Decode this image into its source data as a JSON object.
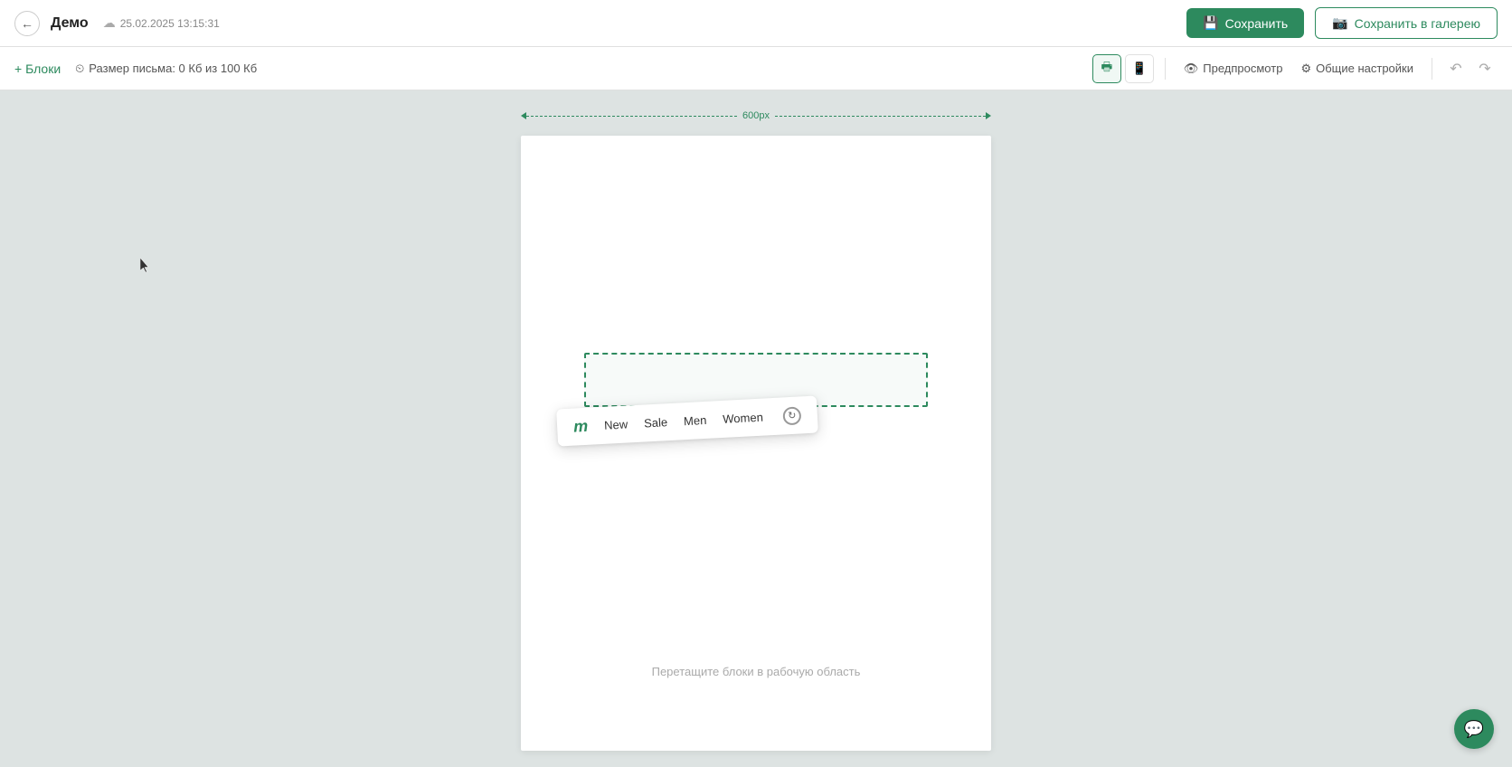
{
  "header": {
    "back_label": "←",
    "title": "Демо",
    "save_time": "25.02.2025 13:15:31",
    "btn_save_label": "Сохранить",
    "btn_save_gallery_label": "Сохранить в галерею"
  },
  "toolbar": {
    "blocks_label": "+ Блоки",
    "letter_size_label": "Размер письма: 0 Кб из 100 Кб",
    "preview_label": "Предпросмотр",
    "settings_label": "Общие настройки"
  },
  "canvas": {
    "width_label": "600px",
    "drop_hint": "Перетащите блоки в рабочую область",
    "nav_logo": "m",
    "nav_items": [
      "New",
      "Sale",
      "Men",
      "Women"
    ]
  },
  "chat": {
    "icon": "💬"
  }
}
